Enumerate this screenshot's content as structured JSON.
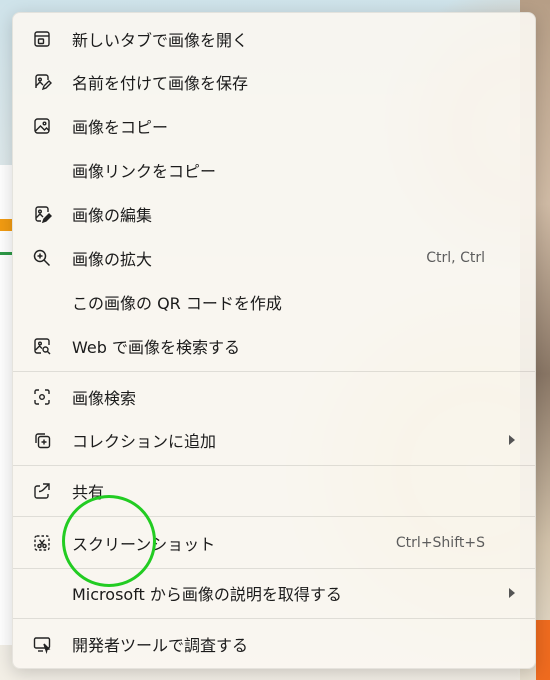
{
  "menu": {
    "items": [
      {
        "label": "新しいタブで画像を開く",
        "icon": "open-in-new-tab-icon"
      },
      {
        "label": "名前を付けて画像を保存",
        "icon": "save-image-icon"
      },
      {
        "label": "画像をコピー",
        "icon": "image-icon"
      },
      {
        "label": "画像リンクをコピー",
        "icon": ""
      },
      {
        "label": "画像の編集",
        "icon": "edit-image-icon"
      },
      {
        "label": "画像の拡大",
        "icon": "zoom-in-icon",
        "shortcut": "Ctrl, Ctrl"
      },
      {
        "label": "この画像の QR コードを作成",
        "icon": ""
      },
      {
        "label": "Web で画像を検索する",
        "icon": "image-search-icon"
      },
      {
        "label": "画像検索",
        "icon": "visual-search-icon"
      },
      {
        "label": "コレクションに追加",
        "icon": "add-collection-icon",
        "submenu": true
      },
      {
        "label": "共有",
        "icon": "share-icon"
      },
      {
        "label": "スクリーンショット",
        "icon": "screenshot-icon",
        "shortcut": "Ctrl+Shift+S"
      },
      {
        "label": "Microsoft から画像の説明を取得する",
        "icon": "",
        "submenu": true
      },
      {
        "label": "開発者ツールで調査する",
        "icon": "devtools-icon"
      }
    ]
  },
  "colors": {
    "annotation_circle": "#22cc22",
    "menu_background": "#faf6f0"
  }
}
